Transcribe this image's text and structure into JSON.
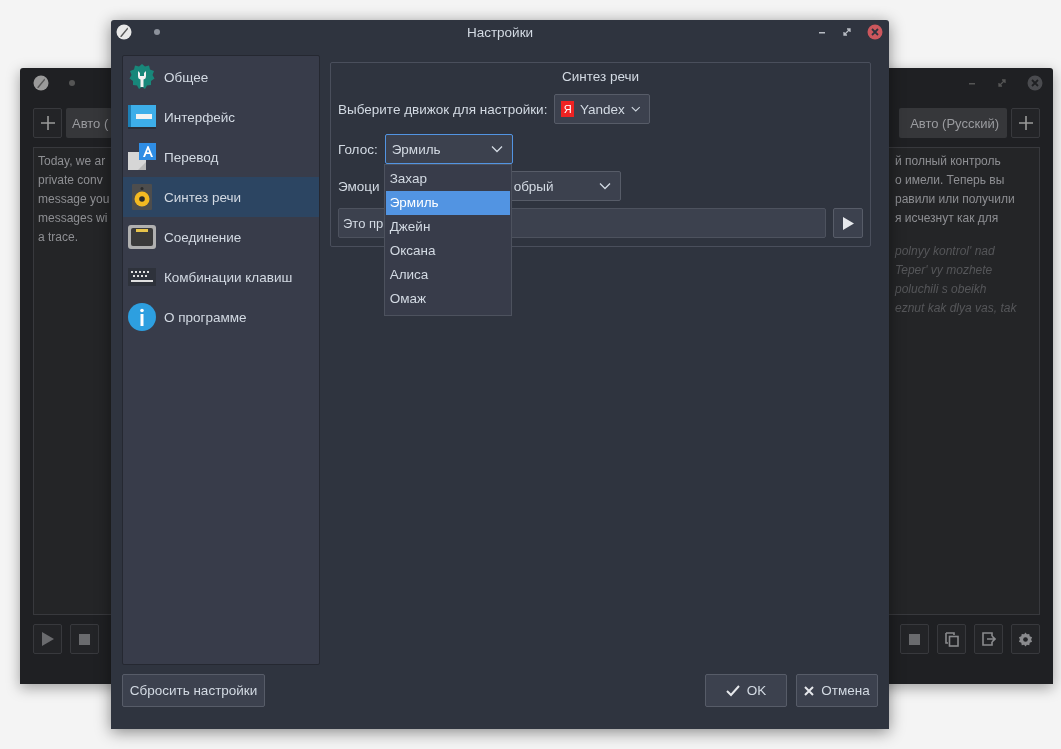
{
  "back_window": {
    "left_language": "Авто (",
    "right_language": "Авто (Русский)",
    "source_text": "Today, we ar\nprivate conv\nmessage you\nmessages wi\na trace.",
    "translation_text": "й полный контроль\nо имели. Теперь вы\nравили или получили\nя исчезнут как для",
    "transliteration_text": "polnyy kontrol' nad\nTeper' vy mozhete\npoluchili s obeikh\neznut kak dlya vas, tak"
  },
  "dialog": {
    "title": "Настройки",
    "sidebar": {
      "items": [
        {
          "label": "Общее",
          "selected": false
        },
        {
          "label": "Интерфейс",
          "selected": false
        },
        {
          "label": "Перевод",
          "selected": false
        },
        {
          "label": "Синтез речи",
          "selected": true
        },
        {
          "label": "Соединение",
          "selected": false
        },
        {
          "label": "Комбинации клавиш",
          "selected": false
        },
        {
          "label": "О программе",
          "selected": false
        }
      ]
    },
    "group_title": "Синтез речи",
    "engine_label": "Выберите движок для настройки:",
    "engine": {
      "logo": "Я",
      "value": "Yandex"
    },
    "voice_label": "Голос:",
    "voice": {
      "value": "Эрмиль",
      "expanded": true,
      "options": [
        {
          "label": "Захар",
          "selected": false
        },
        {
          "label": "Эрмиль",
          "selected": true
        },
        {
          "label": "Джейн",
          "selected": false
        },
        {
          "label": "Оксана",
          "selected": false
        },
        {
          "label": "Алиса",
          "selected": false
        },
        {
          "label": "Омаж",
          "selected": false
        }
      ]
    },
    "emotion_label": "Эмоци",
    "emotion_value": "обрый",
    "sample_text": "Это пр",
    "buttons": {
      "reset": "Сбросить настройки",
      "ok": "OK",
      "cancel": "Отмена"
    }
  }
}
